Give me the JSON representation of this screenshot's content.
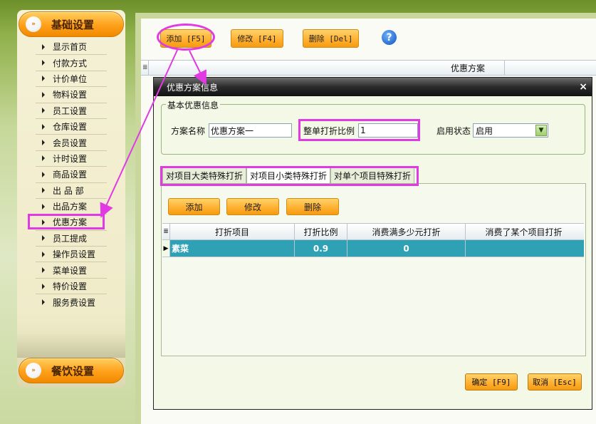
{
  "sidebar": {
    "category_top": "基础设置",
    "category_bottom": "餐饮设置",
    "items": [
      {
        "label": "显示首页"
      },
      {
        "label": "付款方式"
      },
      {
        "label": "计价单位"
      },
      {
        "label": "物料设置"
      },
      {
        "label": "员工设置"
      },
      {
        "label": "仓库设置"
      },
      {
        "label": "会员设置"
      },
      {
        "label": "计时设置"
      },
      {
        "label": "商品设置"
      },
      {
        "label": "出 品 部"
      },
      {
        "label": "出品方案"
      },
      {
        "label": "优惠方案"
      },
      {
        "label": "员工提成"
      },
      {
        "label": "操作员设置"
      },
      {
        "label": "菜单设置"
      },
      {
        "label": "特价设置"
      },
      {
        "label": "服务费设置"
      }
    ]
  },
  "toolbar": {
    "add_label": "添加 [F5]",
    "edit_label": "修改 [F4]",
    "delete_label": "删除 [Del]",
    "help_icon": "?"
  },
  "main_grid": {
    "header": "优惠方案"
  },
  "dialog": {
    "title": "优惠方案信息",
    "close_icon": "×",
    "group_title": "基本优惠信息",
    "scheme_name_label": "方案名称",
    "scheme_name_value": "优惠方案一",
    "discount_ratio_label": "整单打折比例",
    "discount_ratio_value": "1",
    "status_label": "启用状态",
    "status_value": "启用",
    "tabs": [
      {
        "label": "对项目大类特殊打折"
      },
      {
        "label": "对项目小类特殊打折"
      },
      {
        "label": "对单个项目特殊打折"
      }
    ],
    "inner_add": "添加",
    "inner_edit": "修改",
    "inner_delete": "删除",
    "table": {
      "columns": [
        "打折项目",
        "打折比例",
        "消费满多少元打折",
        "消费了某个项目打折"
      ],
      "rows": [
        {
          "item": "素菜",
          "ratio": "0.9",
          "min_amount": "0",
          "item_condition": ""
        }
      ]
    },
    "ok_label": "确定 [F9]",
    "cancel_label": "取消 [Esc]"
  },
  "colors": {
    "annotation": "#e23ae2",
    "button_orange": "#ffae2e",
    "selected_row": "#2ea1b5",
    "title_bar": "#1a1a1a"
  }
}
